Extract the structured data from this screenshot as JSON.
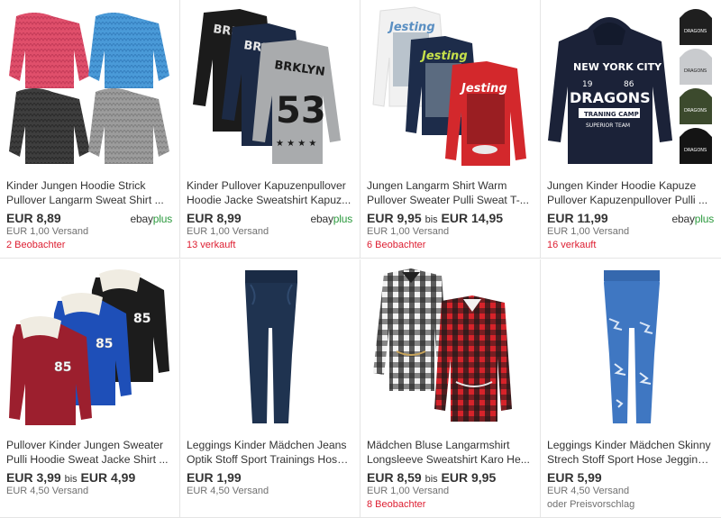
{
  "listings": [
    {
      "title_line1": "Kinder Jungen Hoodie Strick",
      "title_line2": "Pullover Langarm Sweat Shirt ...",
      "price_from": "EUR 8,89",
      "price_sep": "",
      "price_to": "",
      "shipping": "EUR 1,00 Versand",
      "extra": "2 Beobachter",
      "badge": "ebayplus",
      "badge_e": "ebay",
      "badge_p": "plus",
      "image_icon": "knit-sweaters-image"
    },
    {
      "title_line1": "Kinder Pullover Kapuzenpullover",
      "title_line2": "Hoodie Jacke Sweatshirt Kapuz...",
      "price_from": "EUR 8,99",
      "price_sep": "",
      "price_to": "",
      "shipping": "EUR 1,00 Versand",
      "extra": "13 verkauft",
      "badge_e": "ebay",
      "badge_p": "plus",
      "image_icon": "brklyn-sweatshirts-image"
    },
    {
      "title_line1": "Jungen Langarm Shirt Warm",
      "title_line2": "Pullover Sweater Pulli Sweat T-...",
      "price_from": "EUR 9,95",
      "price_sep": "bis",
      "price_to": "EUR 14,95",
      "shipping": "EUR 1,00 Versand",
      "extra": "6 Beobachter",
      "image_icon": "jesting-shirts-image"
    },
    {
      "title_line1": "Jungen Kinder Hoodie Kapuze",
      "title_line2": "Pullover Kapuzenpullover Pulli ...",
      "price_from": "EUR 11,99",
      "price_sep": "",
      "price_to": "",
      "shipping": "EUR 1,00 Versand",
      "extra": "16 verkauft",
      "badge_e": "ebay",
      "badge_p": "plus",
      "image_icon": "dragons-hoodie-image",
      "hoodie_text": [
        "NEW YORK CITY",
        "19",
        "86",
        "DRAGONS",
        "TRANING CAMP",
        "SUPERIOR TEAM"
      ]
    },
    {
      "title_line1": "Pullover Kinder Jungen Sweater",
      "title_line2": "Pulli Hoodie Sweat Jacke Shirt ...",
      "price_from": "EUR 3,99",
      "price_sep": "bis",
      "price_to": "EUR 4,99",
      "shipping": "EUR 4,50 Versand",
      "extra": "",
      "image_icon": "sherpa-collar-sweaters-image"
    },
    {
      "title_line1": "Leggings Kinder Mädchen Jeans",
      "title_line2": "Optik Stoff Sport Trainings Hose...",
      "price_from": "EUR 1,99",
      "price_sep": "",
      "price_to": "",
      "shipping": "EUR 4,50 Versand",
      "extra": "",
      "image_icon": "navy-leggings-image"
    },
    {
      "title_line1": "Mädchen Bluse Langarmshirt",
      "title_line2": "Longsleeve Sweatshirt Karo He...",
      "price_from": "EUR 8,59",
      "price_sep": "bis",
      "price_to": "EUR 9,95",
      "shipping": "EUR 1,00 Versand",
      "extra": "8 Beobachter",
      "image_icon": "plaid-blouses-image"
    },
    {
      "title_line1": "Leggings Kinder Mädchen Skinny",
      "title_line2": "Strech Stoff Sport Hose Jegging...",
      "price_from": "EUR 5,99",
      "price_sep": "",
      "price_to": "",
      "shipping": "EUR 4,50 Versand",
      "extra": "oder Preisvorschlag",
      "image_icon": "ripped-jeggings-image"
    }
  ],
  "brklyn_text": [
    "BRKLYN",
    "53"
  ],
  "jesting_text": "Jesting",
  "sweater_text": "85",
  "colors": {
    "watch_red": "#dd1e31",
    "plus_green": "#2c9a3e",
    "muted": "#707070"
  }
}
